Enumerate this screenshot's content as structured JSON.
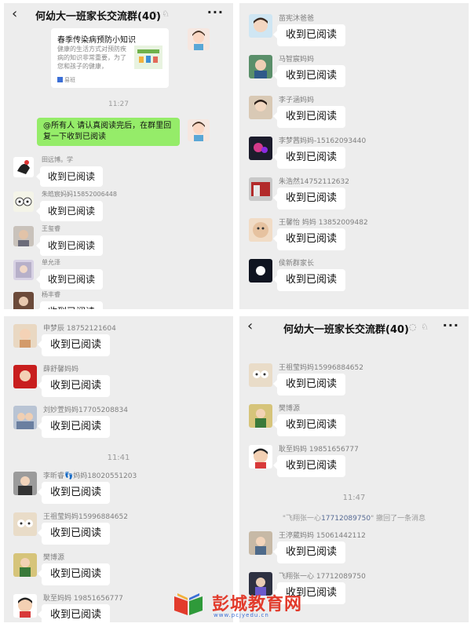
{
  "chat_title": "何幼大一班家长交流群(40)",
  "colors": {
    "bubble_self": "#95ec69",
    "chat_bg": "#ededed",
    "link": "#576b95",
    "watermark_red": "#e23b2c"
  },
  "panel1": {
    "card": {
      "title": "春季传染病预防小知识",
      "desc": "健康的生活方式对预防疾病的知识非常重要，为了您和孩子的健康，",
      "source": "易班"
    },
    "time": "11:27",
    "self_message": "@所有人 请认真阅读完后，在群里回复一下收到已阅读",
    "messages": [
      {
        "sender": "田远博。学",
        "text": "收到已阅读"
      },
      {
        "sender": "朱皓宸妈妈15852006448",
        "text": "收到已阅读"
      },
      {
        "sender": "王玺睿",
        "text": "收到已阅读"
      },
      {
        "sender": "单允泽",
        "text": "收到已阅读"
      },
      {
        "sender": "杨丰睿",
        "text": "收到已阅读"
      }
    ]
  },
  "panel2": {
    "messages": [
      {
        "sender": "苗宪沐爸爸",
        "text": "收到已阅读"
      },
      {
        "sender": "马智宸妈妈",
        "text": "收到已阅读"
      },
      {
        "sender": "李子涵妈妈",
        "text": "收到已阅读"
      },
      {
        "sender": "李梦茜妈妈-15162093440",
        "text": "收到已阅读"
      },
      {
        "sender": "朱浩然14752112632",
        "text": "收到已阅读"
      },
      {
        "sender": "王馨怡 妈妈 13852009482",
        "text": "收到已阅读"
      },
      {
        "sender": "侯新群家长",
        "text": "收到已阅读"
      }
    ]
  },
  "panel3": {
    "messages_top": [
      {
        "sender": "申梦辰 18752121604",
        "text": "收到已阅读"
      },
      {
        "sender": "薛舒馨妈妈",
        "text": "收到已阅读"
      },
      {
        "sender": "刘妙萱妈妈17705208834",
        "text": "收到已阅读"
      }
    ],
    "time": "11:41",
    "messages_bottom": [
      {
        "sender": "李昕睿👣妈妈18020551203",
        "text": "收到已阅读"
      },
      {
        "sender": "王祖莹妈妈15996884652",
        "text": "收到已阅读"
      },
      {
        "sender": "樊博源",
        "text": "收到已阅读"
      },
      {
        "sender": "耿至妈妈 19851656777",
        "text": "收到已阅读"
      }
    ]
  },
  "panel4": {
    "messages_top": [
      {
        "sender": "王祖莹妈妈15996884652",
        "text": "收到已阅读"
      },
      {
        "sender": "樊博源",
        "text": "收到已阅读"
      },
      {
        "sender": "耿至妈妈 19851656777",
        "text": "收到已阅读"
      }
    ],
    "time": "11:47",
    "recall": {
      "pre": "\"飞翔张一心",
      "phone": "17712089750",
      "post": "\" 撤回了一条消息"
    },
    "messages_bottom": [
      {
        "sender": "王渟葳妈妈 15061442112",
        "text": "收到已阅读"
      },
      {
        "sender": "飞翔张一心 17712089750",
        "text": "收到已阅读"
      }
    ]
  },
  "watermark": {
    "text": "彭城教育网",
    "sub": "www.pcjyedu.cn"
  }
}
